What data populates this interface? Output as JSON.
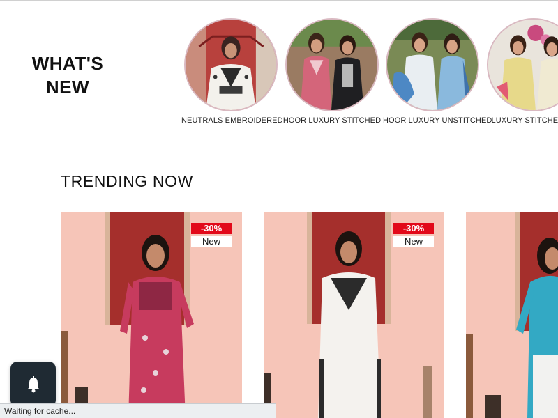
{
  "whats_new": {
    "title": "WHAT'S\nNEW",
    "categories": [
      {
        "label": "NEUTRALS EMBROIDERED",
        "icon": "outfit-photo-white-kurta"
      },
      {
        "label": "HOOR LUXURY STITCHED",
        "icon": "outfit-photo-pink-black"
      },
      {
        "label": "HOOR LUXURY UNSTITCHED",
        "icon": "outfit-photo-white-blue"
      },
      {
        "label": "LUXURY STITCHED PA",
        "icon": "outfit-photo-yellow-floral"
      }
    ]
  },
  "trending": {
    "title": "TRENDING NOW",
    "products": [
      {
        "discount": "-30%",
        "tag": "New",
        "dress_color": "#c73b5e"
      },
      {
        "discount": "-30%",
        "tag": "New",
        "dress_color": "#f4f2ee"
      },
      {
        "discount": "",
        "tag": "",
        "dress_color": "#33a9c4"
      }
    ]
  },
  "notify": {
    "icon": "bell-icon"
  },
  "status": {
    "text": "Waiting for cache..."
  },
  "colors": {
    "accent": "#e2091a",
    "background": "#ffffff",
    "card_background": "#f6c7bb"
  }
}
